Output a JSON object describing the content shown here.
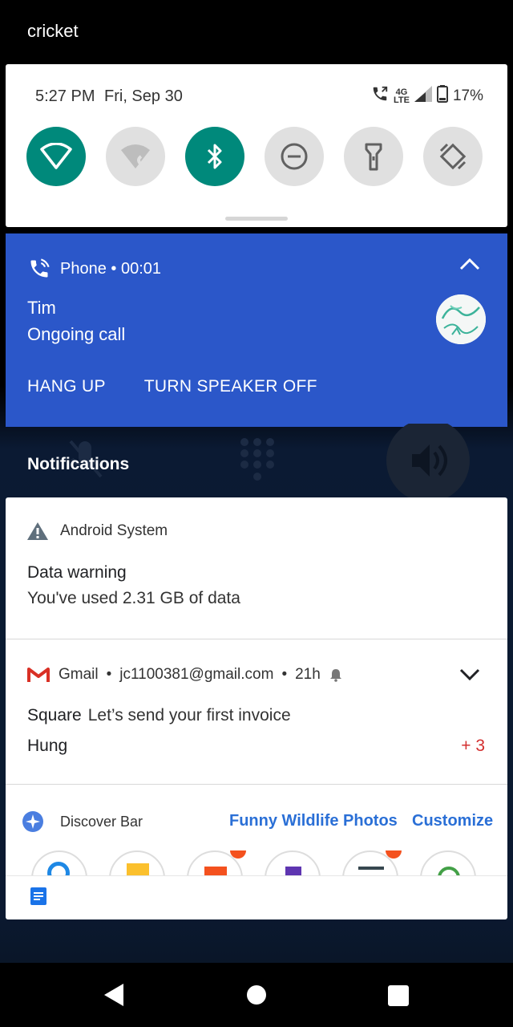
{
  "status_bar": {
    "carrier": "cricket"
  },
  "quick_settings": {
    "time": "5:27 PM",
    "date": "Fri, Sep 30",
    "network": "4G LTE",
    "battery": "17%",
    "tiles": [
      {
        "name": "wifi",
        "state": "on"
      },
      {
        "name": "mobile-data",
        "state": "off"
      },
      {
        "name": "bluetooth",
        "state": "on"
      },
      {
        "name": "do-not-disturb",
        "state": "off"
      },
      {
        "name": "flashlight",
        "state": "off"
      },
      {
        "name": "auto-rotate",
        "state": "off"
      }
    ],
    "accent_color": "#00897b"
  },
  "call_notification": {
    "app": "Phone",
    "duration": "00:01",
    "caller": "Tim",
    "status": "Ongoing call",
    "actions": {
      "hang_up": "HANG UP",
      "speaker": "TURN SPEAKER OFF"
    },
    "color": "#2b57c9"
  },
  "section_label": "Notifications",
  "notifications": {
    "android_system": {
      "app": "Android System",
      "title": "Data warning",
      "text": "You've used 2.31 GB of data"
    },
    "gmail": {
      "app": "Gmail",
      "account": "jc1100381@gmail.com",
      "age": "21h",
      "sender": "Square",
      "subject": "Let’s send your first invoice",
      "second_sender": "Hung",
      "more_count": "+ 3"
    },
    "discover_bar": {
      "app": "Discover Bar",
      "link1": "Funny Wildlife Photos",
      "link2": "Customize"
    }
  }
}
